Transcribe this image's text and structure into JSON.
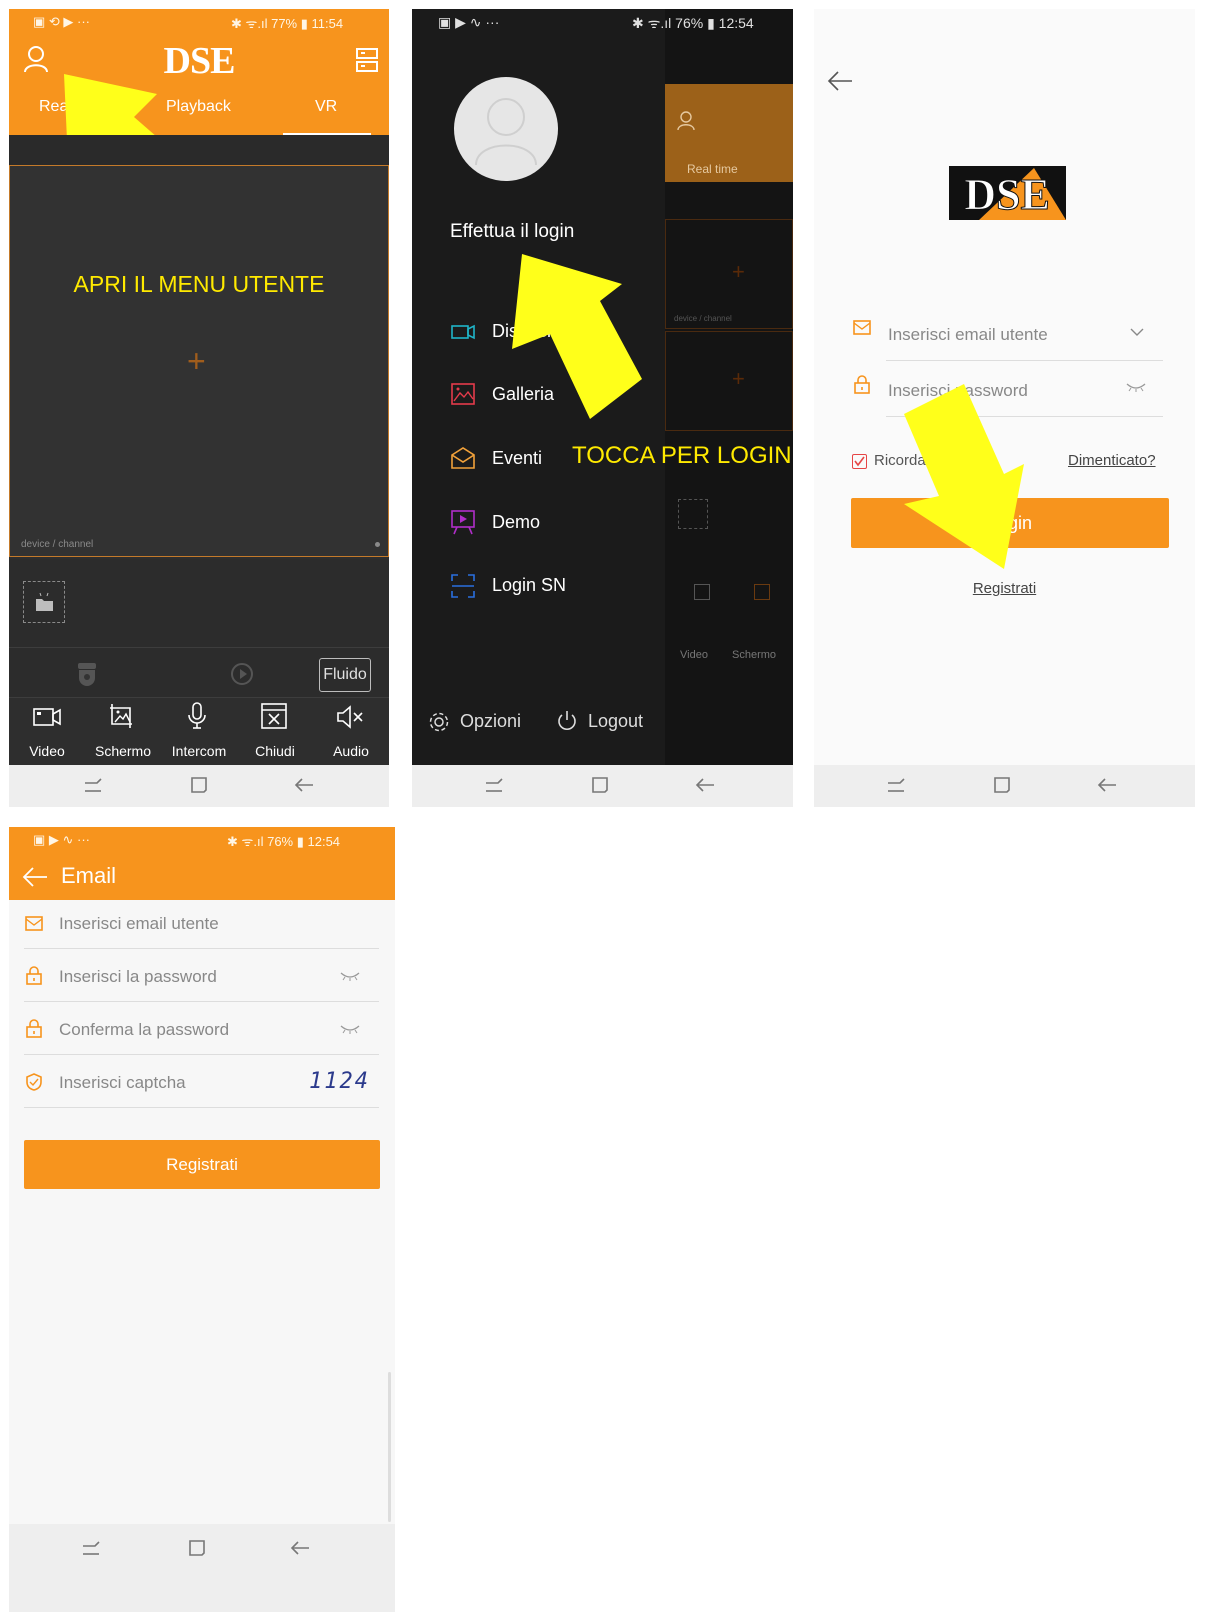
{
  "colors": {
    "accent": "#f7941d",
    "annotation_yellow": "#ffea00",
    "dark_bg": "#2e2e2e"
  },
  "screen1": {
    "status": {
      "left_icons": "▣ ⟲ ▶ ···",
      "right": "✱ ᯤ.ıl 77% ▮ 11:54"
    },
    "logo": "DSE",
    "tabs": [
      "Real time",
      "Playback",
      "VR"
    ],
    "annotation": "APRI IL MENU UTENTE",
    "device_label": "device / channel",
    "quality_button": "Fluido",
    "toolbar": [
      "Video",
      "Schermo",
      "Intercom",
      "Chiudi",
      "Audio"
    ],
    "icons": [
      "user-icon",
      "device-list-icon",
      "add-icon",
      "folder-icon",
      "camera-icon",
      "screenshot-icon",
      "microphone-icon",
      "close-window-icon",
      "mute-icon"
    ]
  },
  "screen2": {
    "status": {
      "left_icons": "▣ ▶ ∿ ···",
      "right": "✱ ᯤ.ıl 76% ▮ 12:54"
    },
    "login_label": "Effettua il login",
    "menu": [
      "Dispositivi",
      "Galleria",
      "Eventi",
      "Demo",
      "Login SN"
    ],
    "annotation": "TOCCA PER LOGIN",
    "options_label": "Opzioni",
    "logout_label": "Logout",
    "background": {
      "realtime_tab": "Real time",
      "device_label": "device / channel",
      "video": "Video",
      "schermo": "Schermo"
    }
  },
  "screen3": {
    "logo": "DSE",
    "email_placeholder": "Inserisci email utente",
    "password_placeholder": "Inserisci password",
    "remember_label": "Ricorda password",
    "forgot_link": "Dimenticato?",
    "login_button": "Login",
    "register_link": "Registrati"
  },
  "screen4": {
    "status": {
      "left_icons": "▣ ▶ ∿ ···",
      "right": "✱ ᯤ.ıl 76% ▮ 12:54"
    },
    "title": "Email",
    "fields": [
      {
        "placeholder": "Inserisci email utente",
        "icon": "mail-icon"
      },
      {
        "placeholder": "Inserisci la password",
        "icon": "lock-icon"
      },
      {
        "placeholder": "Conferma la password",
        "icon": "lock-icon"
      },
      {
        "placeholder": "Inserisci captcha",
        "icon": "shield-icon"
      }
    ],
    "captcha_value": "1124",
    "register_button": "Registrati"
  }
}
